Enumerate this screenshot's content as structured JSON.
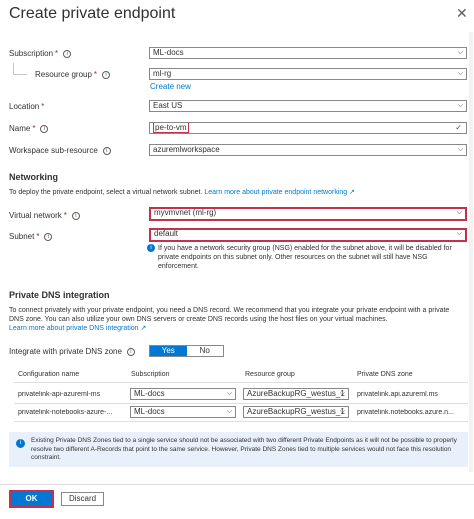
{
  "title": "Create private endpoint",
  "close_glyph": "✕",
  "fields": {
    "subscription": {
      "label": "Subscription",
      "value": "ML-docs"
    },
    "resource_group": {
      "label": "Resource group",
      "value": "ml-rg",
      "create_new": "Create new"
    },
    "location": {
      "label": "Location",
      "value": "East US"
    },
    "name": {
      "label": "Name",
      "value": "pe-to-vm"
    },
    "workspace_sub_resource": {
      "label": "Workspace sub-resource",
      "value": "azuremlworkspace"
    }
  },
  "networking": {
    "heading": "Networking",
    "intro": "To deploy the private endpoint, select a virtual network subnet.",
    "learn_more": "Learn more about private endpoint networking",
    "virtual_network": {
      "label": "Virtual network",
      "value": "myvmvnet (ml-rg)"
    },
    "subnet": {
      "label": "Subnet",
      "value": "default"
    },
    "nsg_note": "If you have a network security group (NSG) enabled for the subnet above, it will be disabled for private endpoints on this subnet only. Other resources on the subnet will still have NSG enforcement."
  },
  "dns": {
    "heading": "Private DNS integration",
    "intro": "To connect privately with your private endpoint, you need a DNS record. We recommend that you integrate your private endpoint with a private DNS zone. You can also utilize your own DNS servers or create DNS records using the host files on your virtual machines.",
    "learn_more": "Learn more about private DNS integration",
    "integrate_label": "Integrate with private DNS zone",
    "toggle": {
      "yes": "Yes",
      "no": "No",
      "selected": "Yes"
    },
    "columns": [
      "Configuration name",
      "Subscription",
      "Resource group",
      "Private DNS zone"
    ],
    "rows": [
      {
        "config": "privatelink-api-azureml-ms",
        "subscription": "ML-docs",
        "resource_group": "AzureBackupRG_westus_1",
        "zone": "privatelink.api.azureml.ms"
      },
      {
        "config": "privatelink-notebooks-azure-...",
        "subscription": "ML-docs",
        "resource_group": "AzureBackupRG_westus_1",
        "zone": "privatelink.notebooks.azure.n..."
      }
    ]
  },
  "banner": "Existing Private DNS Zones tied to a single service should not be associated with two different Private Endpoints as it will not be possible to properly resolve two different A-Records that point to the same service. However, Private DNS Zones tied to multiple services would not face this resolution constraint.",
  "footer": {
    "ok": "OK",
    "discard": "Discard"
  },
  "colors": {
    "accent": "#0078d4",
    "highlight": "#c4314b"
  }
}
